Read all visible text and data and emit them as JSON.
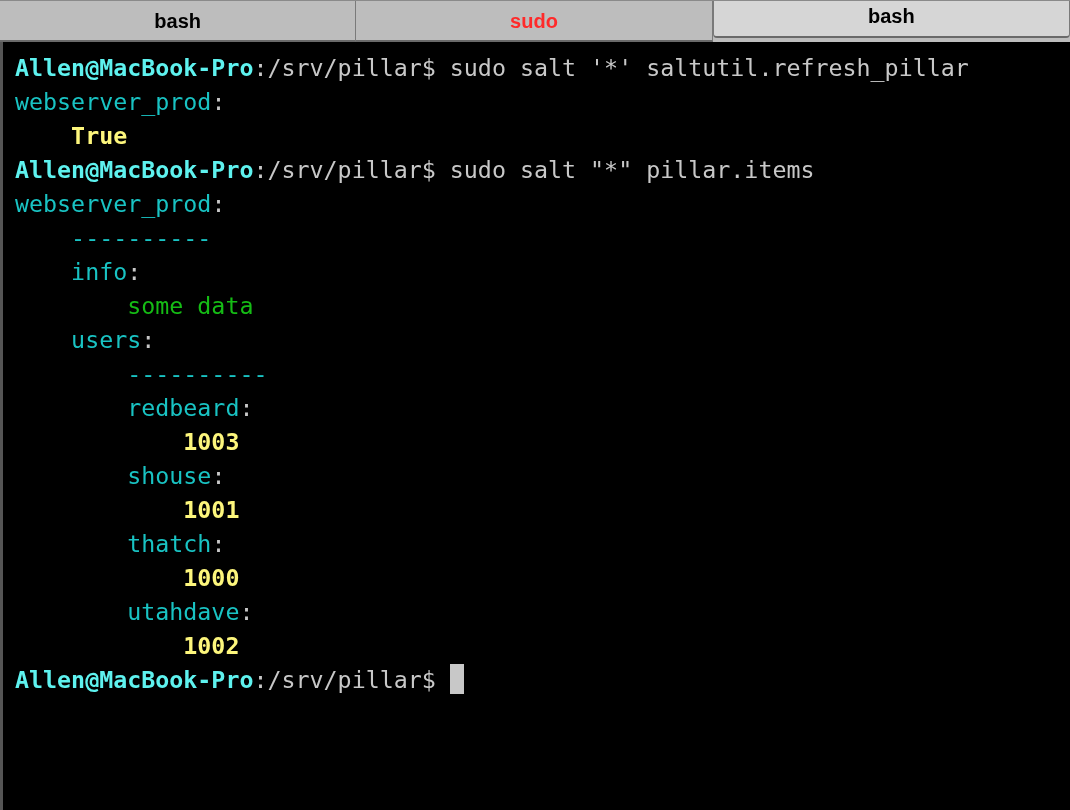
{
  "tabs": [
    {
      "label": "bash",
      "selected": false,
      "color": "#000000"
    },
    {
      "label": "sudo",
      "selected": false,
      "color": "#ff2a2a"
    },
    {
      "label": "bash",
      "selected": true,
      "color": "#000000"
    }
  ],
  "terminal": {
    "lines": [
      {
        "segments": [
          {
            "kind": "host",
            "text": "Allen@MacBook-Pro"
          },
          {
            "kind": "plain",
            "text": ":/srv/pillar$ sudo salt '*' saltutil.refresh_pillar"
          }
        ]
      },
      {
        "segments": [
          {
            "kind": "key",
            "text": "webserver_prod"
          },
          {
            "kind": "plain",
            "text": ":"
          }
        ]
      },
      {
        "segments": [
          {
            "kind": "value",
            "text": "    True"
          }
        ]
      },
      {
        "segments": [
          {
            "kind": "host",
            "text": "Allen@MacBook-Pro"
          },
          {
            "kind": "plain",
            "text": ":/srv/pillar$ sudo salt \"*\" pillar.items"
          }
        ]
      },
      {
        "segments": [
          {
            "kind": "key",
            "text": "webserver_prod"
          },
          {
            "kind": "plain",
            "text": ":"
          }
        ]
      },
      {
        "segments": [
          {
            "kind": "key",
            "text": "    ----------"
          }
        ]
      },
      {
        "segments": [
          {
            "kind": "key",
            "text": "    info"
          },
          {
            "kind": "plain",
            "text": ":"
          }
        ]
      },
      {
        "segments": [
          {
            "kind": "string",
            "text": "        some data"
          }
        ]
      },
      {
        "segments": [
          {
            "kind": "key",
            "text": "    users"
          },
          {
            "kind": "plain",
            "text": ":"
          }
        ]
      },
      {
        "segments": [
          {
            "kind": "key",
            "text": "        ----------"
          }
        ]
      },
      {
        "segments": [
          {
            "kind": "key",
            "text": "        redbeard"
          },
          {
            "kind": "plain",
            "text": ":"
          }
        ]
      },
      {
        "segments": [
          {
            "kind": "value",
            "text": "            1003"
          }
        ]
      },
      {
        "segments": [
          {
            "kind": "key",
            "text": "        shouse"
          },
          {
            "kind": "plain",
            "text": ":"
          }
        ]
      },
      {
        "segments": [
          {
            "kind": "value",
            "text": "            1001"
          }
        ]
      },
      {
        "segments": [
          {
            "kind": "key",
            "text": "        thatch"
          },
          {
            "kind": "plain",
            "text": ":"
          }
        ]
      },
      {
        "segments": [
          {
            "kind": "value",
            "text": "            1000"
          }
        ]
      },
      {
        "segments": [
          {
            "kind": "key",
            "text": "        utahdave"
          },
          {
            "kind": "plain",
            "text": ":"
          }
        ]
      },
      {
        "segments": [
          {
            "kind": "value",
            "text": "            1002"
          }
        ]
      },
      {
        "cursor": true,
        "segments": [
          {
            "kind": "host",
            "text": "Allen@MacBook-Pro"
          },
          {
            "kind": "plain",
            "text": ":/srv/pillar$ "
          }
        ]
      }
    ]
  }
}
